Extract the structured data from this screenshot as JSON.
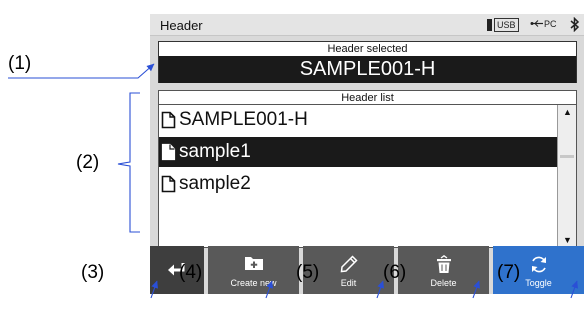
{
  "title_bar": {
    "title": "Header",
    "usb_label": "USB",
    "pc_label": "PC"
  },
  "header_selected": {
    "caption": "Header selected",
    "value": "SAMPLE001-H"
  },
  "header_list": {
    "caption": "Header list",
    "items": [
      {
        "label": "SAMPLE001-H",
        "selected": false,
        "icon": "file-outline-icon"
      },
      {
        "label": "sample1",
        "selected": true,
        "icon": "file-filled-icon"
      },
      {
        "label": "sample2",
        "selected": false,
        "icon": "file-outline-icon"
      }
    ],
    "scroll_up": "▲",
    "scroll_down": "▼"
  },
  "buttons": {
    "back": {
      "icon": "return-arrow-icon"
    },
    "create_new": {
      "label": "Create new",
      "icon": "folder-plus-icon"
    },
    "edit": {
      "label": "Edit",
      "icon": "pencil-icon"
    },
    "delete": {
      "label": "Delete",
      "icon": "trash-icon"
    },
    "toggle": {
      "label": "Toggle",
      "icon": "refresh-icon"
    }
  },
  "callouts": {
    "c1": "(1)",
    "c2": "(2)",
    "c3": "(3)",
    "c4": "(4)",
    "c5": "(5)",
    "c6": "(6)",
    "c7": "(7)"
  },
  "colors": {
    "toggle_button": "#2f72cc",
    "button_gray": "#595959",
    "callout_line": "#2a4fd6",
    "selected_bg": "#1a1a1a"
  }
}
